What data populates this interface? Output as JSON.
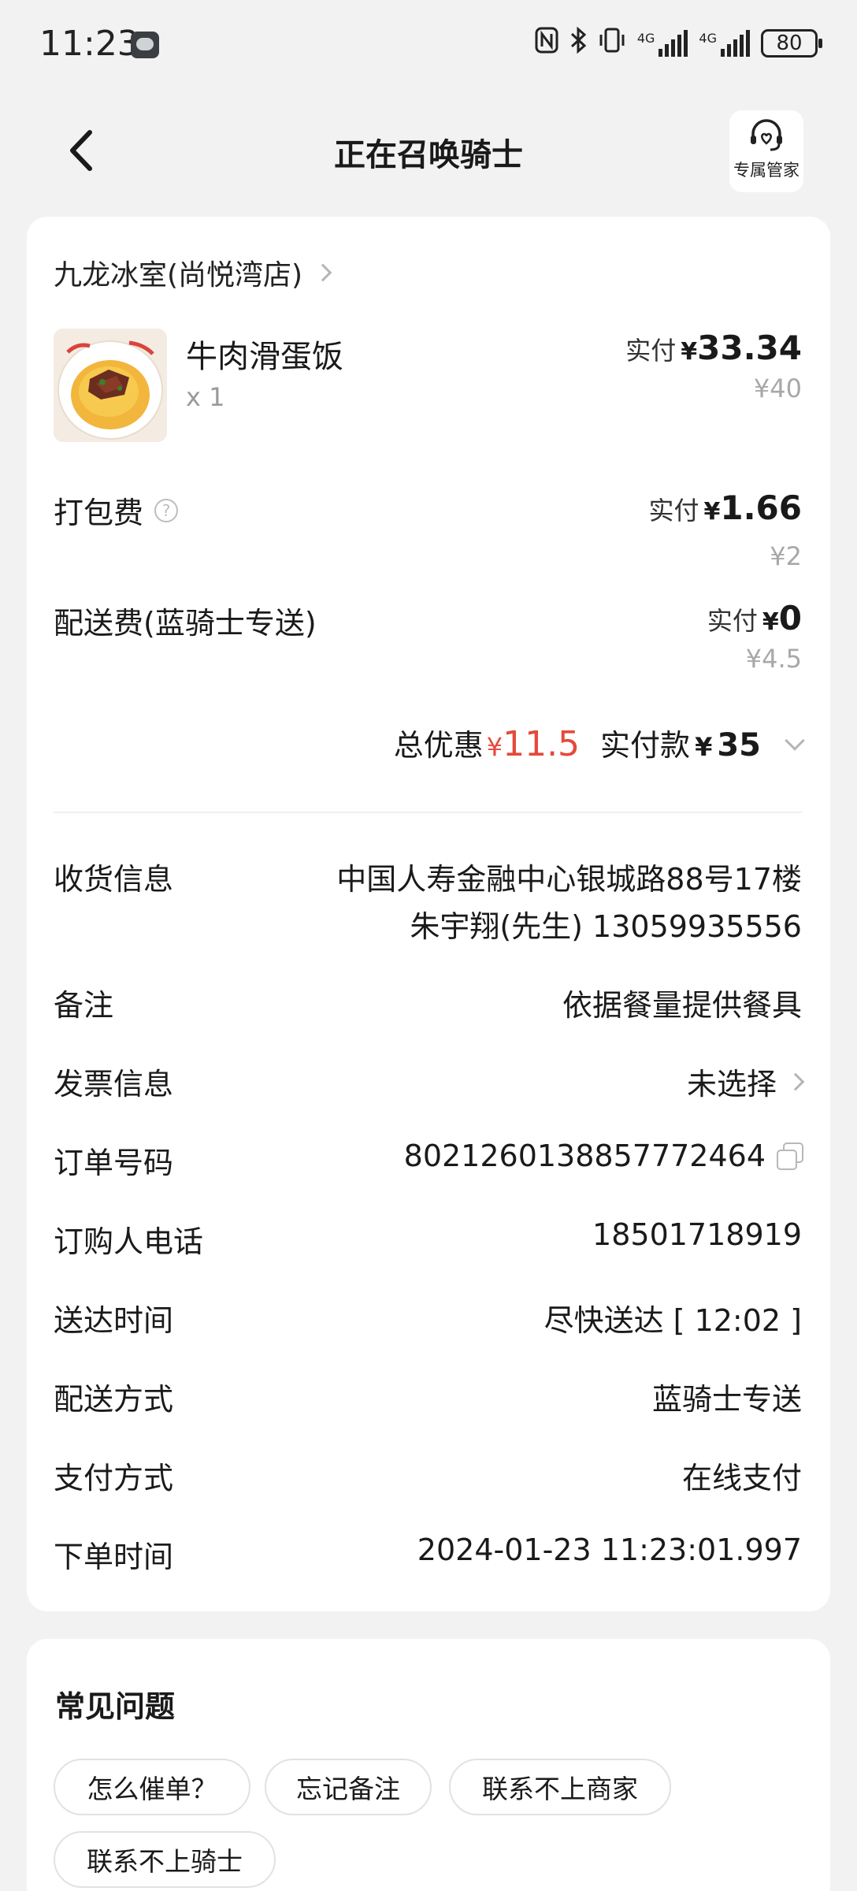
{
  "status_bar": {
    "time": "11:23",
    "icons": [
      "message-icon",
      "nfc-icon",
      "bluetooth-icon",
      "vibrate-icon",
      "signal-4g-icon",
      "signal-4g-icon",
      "battery-icon"
    ],
    "net_label_1": "4G",
    "net_label_2": "4G",
    "battery": "80"
  },
  "header": {
    "back_icon": "chevron-left-icon",
    "title": "正在召唤骑士",
    "butler_label": "专属管家"
  },
  "order": {
    "store_name": "九龙冰室(尚悦湾店)",
    "item": {
      "name": "牛肉滑蛋饭",
      "qty": "x 1",
      "paid_label": "实付",
      "currency": "¥",
      "paid_value": "33.34",
      "original": "¥40"
    },
    "packing_fee": {
      "label": "打包费",
      "help": "?",
      "paid_label": "实付",
      "currency": "¥",
      "paid_value": "1.66",
      "original": "¥2"
    },
    "delivery_fee": {
      "label": "配送费(蓝骑士专送)",
      "paid_label": "实付",
      "currency": "¥",
      "paid_value": "0",
      "original": "¥4.5"
    },
    "totals": {
      "discount_label": "总优惠",
      "discount_currency": "¥",
      "discount_value": "11.5",
      "paid_label": "实付款",
      "paid_currency": "¥",
      "paid_value": "35"
    },
    "info": {
      "address_label": "收货信息",
      "address_line1": "中国人寿金融中心银城路88号17楼",
      "address_line2": "朱宇翔(先生) 13059935556",
      "remark_label": "备注",
      "remark_value": "依据餐量提供餐具",
      "invoice_label": "发票信息",
      "invoice_value": "未选择",
      "order_no_label": "订单号码",
      "order_no_value": "8021260138857772464",
      "phone_label": "订购人电话",
      "phone_value": "18501718919",
      "delivery_time_label": "送达时间",
      "delivery_time_value": "尽快送达 [ 12:02 ]",
      "delivery_method_label": "配送方式",
      "delivery_method_value": "蓝骑士专送",
      "payment_label": "支付方式",
      "payment_value": "在线支付",
      "order_time_label": "下单时间",
      "order_time_value": "2024-01-23 11:23:01.997"
    }
  },
  "faq": {
    "title": "常见问题",
    "chips": [
      "怎么催单？",
      "忘记备注",
      "联系不上商家",
      "联系不上骑士"
    ]
  },
  "colors": {
    "background": "#f2f2f2",
    "card": "#ffffff",
    "discount_red": "#e5493a",
    "muted_gray": "#a8a8a8"
  }
}
